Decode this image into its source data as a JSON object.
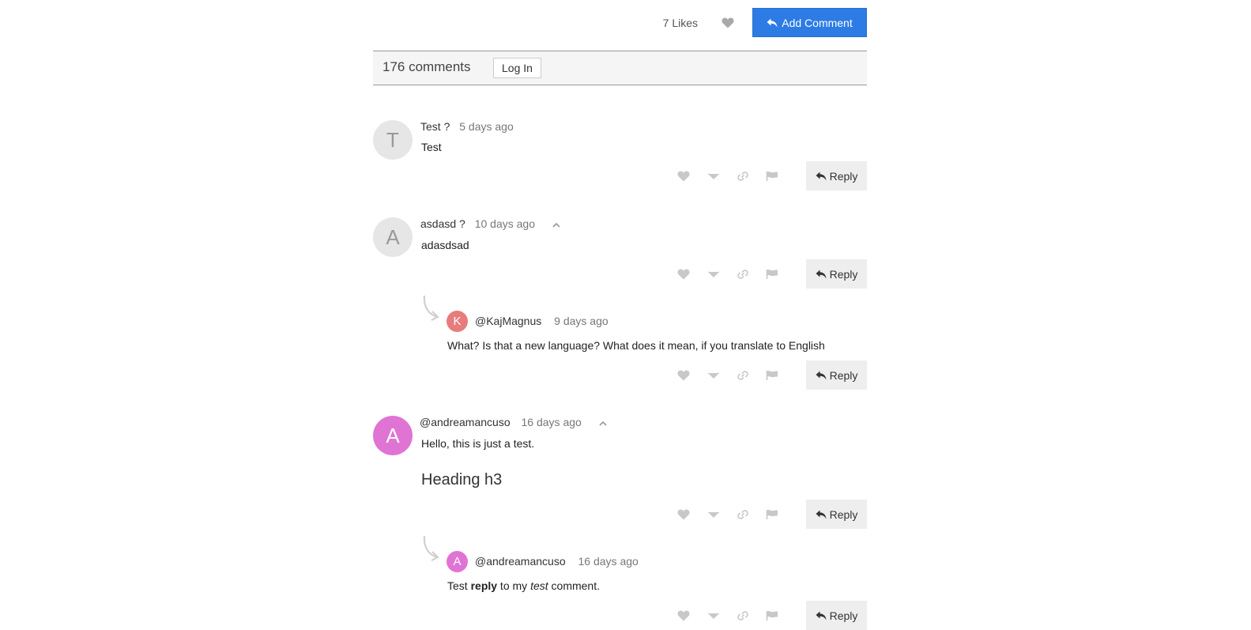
{
  "topbar": {
    "likes": "7 Likes",
    "add_comment": "Add Comment"
  },
  "header": {
    "count": "176 comments",
    "login": "Log In"
  },
  "colors": {
    "primary": "#2d7be5",
    "avatar_gray": "#e6e6e6",
    "avatar_red": "#e77c7c",
    "avatar_pink": "#e074d4",
    "icon_gray": "#c8c8c8"
  },
  "comments": [
    {
      "avatar": "T",
      "author": "Test ?",
      "time": "5 days ago",
      "text": "Test",
      "reply": "Reply"
    },
    {
      "avatar": "A",
      "author": "asdasd ?",
      "time": "10 days ago",
      "text": "adasdsad",
      "reply": "Reply",
      "replies": [
        {
          "avatar": "K",
          "author": "@KajMagnus",
          "time": "9 days ago",
          "text": "What? Is that a new language? What does it mean, if you translate to English",
          "reply": "Reply"
        }
      ]
    },
    {
      "avatar": "A",
      "author": "@andreamancuso",
      "time": "16 days ago",
      "text": "Hello, this is just a test.",
      "heading": "Heading h3",
      "reply": "Reply",
      "replies": [
        {
          "avatar": "A",
          "author": "@andreamancuso",
          "time": "16 days ago",
          "text_parts": [
            "Test ",
            "reply",
            " to my ",
            "test",
            " comment."
          ],
          "reply": "Reply"
        }
      ]
    }
  ]
}
